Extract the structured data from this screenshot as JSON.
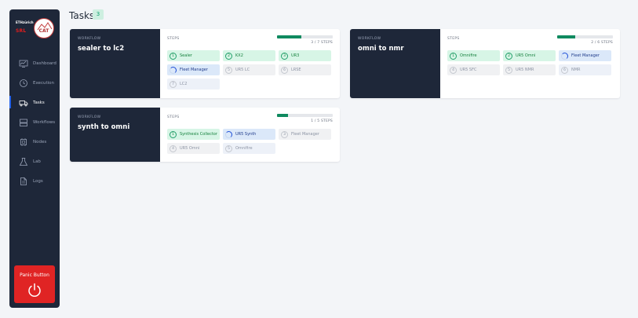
{
  "brand": {
    "eth": "ETHzürich",
    "srl": "SRL",
    "logo_text": "CAT"
  },
  "nav": [
    {
      "label": "Dashboard",
      "icon": "dashboard-icon"
    },
    {
      "label": "Execution",
      "icon": "clock-icon"
    },
    {
      "label": "Tasks",
      "icon": "truck-icon",
      "active": true
    },
    {
      "label": "Workflows",
      "icon": "workflow-icon"
    },
    {
      "label": "Nodes",
      "icon": "chip-icon"
    },
    {
      "label": "Lab",
      "icon": "flask-icon"
    },
    {
      "label": "Logs",
      "icon": "document-icon"
    }
  ],
  "panic": {
    "label": "Panic Button"
  },
  "header": {
    "title": "Tasks",
    "count": "3"
  },
  "cards": [
    {
      "workflow_label": "WORKFLOW",
      "title": "sealer to lc2",
      "steps_label": "STEPS",
      "progress_text": "3 / 7 STEPS",
      "progress": 0.43,
      "steps": [
        {
          "num": "1",
          "name": "Sealer",
          "status": "done"
        },
        {
          "num": "2",
          "name": "KX2",
          "status": "done"
        },
        {
          "num": "3",
          "name": "UR3",
          "status": "done"
        },
        {
          "num": "",
          "name": "Fleet Manager",
          "status": "running"
        },
        {
          "num": "5",
          "name": "UR5 LC",
          "status": "pending"
        },
        {
          "num": "6",
          "name": "LRSE",
          "status": "pending"
        },
        {
          "num": "7",
          "name": "LC2",
          "status": "next"
        }
      ]
    },
    {
      "workflow_label": "WORKFLOW",
      "title": "omni to nmr",
      "steps_label": "STEPS",
      "progress_text": "2 / 6 STEPS",
      "progress": 0.33,
      "steps": [
        {
          "num": "1",
          "name": "Omnifire",
          "status": "done"
        },
        {
          "num": "2",
          "name": "UR5 Omni",
          "status": "done"
        },
        {
          "num": "",
          "name": "Fleet Manager",
          "status": "running"
        },
        {
          "num": "4",
          "name": "UR5 SFC",
          "status": "pending"
        },
        {
          "num": "5",
          "name": "UR5 NMR",
          "status": "pending"
        },
        {
          "num": "6",
          "name": "NMR",
          "status": "next"
        }
      ]
    },
    {
      "workflow_label": "WORKFLOW",
      "title": "synth to omni",
      "steps_label": "STEPS",
      "progress_text": "1 / 5 STEPS",
      "progress": 0.2,
      "steps": [
        {
          "num": "1",
          "name": "Synthesis Collector",
          "status": "done"
        },
        {
          "num": "",
          "name": "UR5 Synth",
          "status": "running"
        },
        {
          "num": "3",
          "name": "Fleet Manager",
          "status": "pending"
        },
        {
          "num": "4",
          "name": "UR5 Omni",
          "status": "pending"
        },
        {
          "num": "5",
          "name": "Omnifire",
          "status": "next"
        }
      ]
    }
  ]
}
